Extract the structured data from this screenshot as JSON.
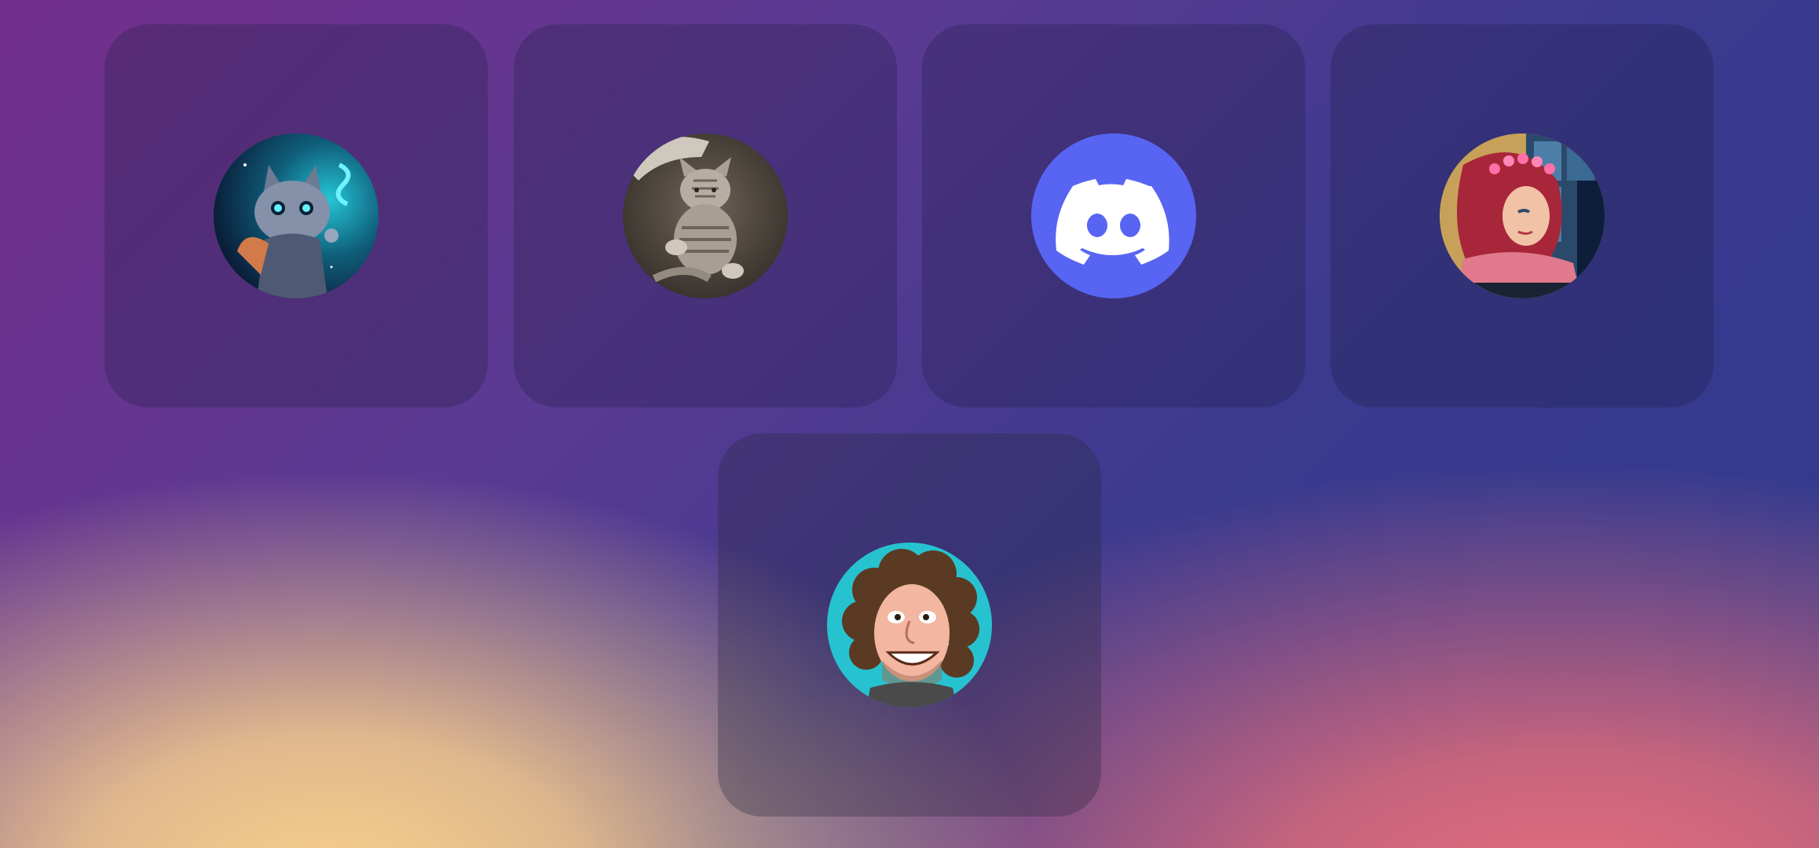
{
  "screen": {
    "type": "avatar-picker-grid"
  },
  "accounts": [
    {
      "id": "cat-wizard",
      "icon": "cat-wizard-avatar-icon",
      "accent": "#1fb6c9"
    },
    {
      "id": "kitten",
      "icon": "kitten-photo-avatar-icon",
      "accent": "#6f6a62"
    },
    {
      "id": "discord",
      "icon": "discord-logo-icon",
      "accent": "#5865F2"
    },
    {
      "id": "mermaid",
      "icon": "mermaid-avatar-icon",
      "accent": "#c0385b"
    },
    {
      "id": "caricature",
      "icon": "curly-hair-caricature-avatar-icon",
      "accent": "#27c2cf"
    }
  ],
  "colors": {
    "background_top_left": "#732f8c",
    "background_top_right": "#2f3a8e",
    "background_bottom_left": "#f8ce8c",
    "background_bottom_right": "#e86e7a",
    "tile": "rgba(30,30,60,0.28)"
  }
}
